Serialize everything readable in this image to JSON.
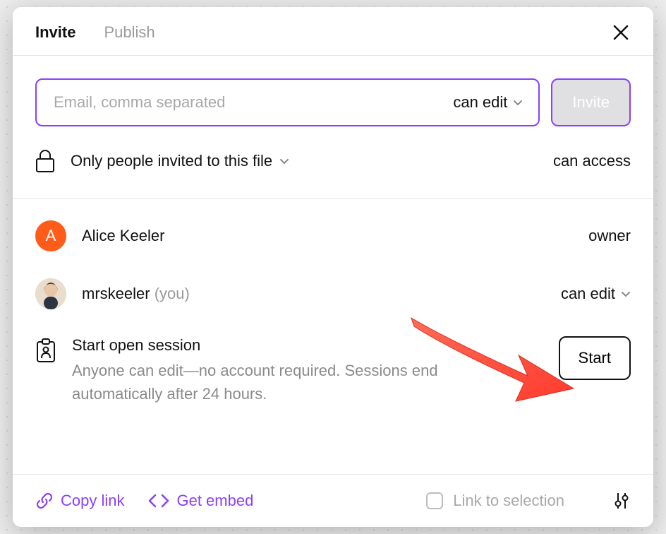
{
  "tabs": {
    "invite": "Invite",
    "publish": "Publish"
  },
  "email": {
    "placeholder": "Email, comma separated",
    "permission": "can edit",
    "invite_button": "Invite"
  },
  "access": {
    "scope": "Only people invited to this file",
    "right": "can access"
  },
  "people": [
    {
      "initial": "A",
      "name": "Alice Keeler",
      "you": "",
      "role": "owner",
      "role_dropdown": false
    },
    {
      "initial": "",
      "name": "mrskeeler",
      "you": "(you)",
      "role": "can edit",
      "role_dropdown": true
    }
  ],
  "session": {
    "title": "Start open session",
    "desc": "Anyone can edit—no account required. Sessions end automatically after 24 hours.",
    "button": "Start"
  },
  "footer": {
    "copy_link": "Copy link",
    "get_embed": "Get embed",
    "link_to_selection": "Link to selection"
  }
}
